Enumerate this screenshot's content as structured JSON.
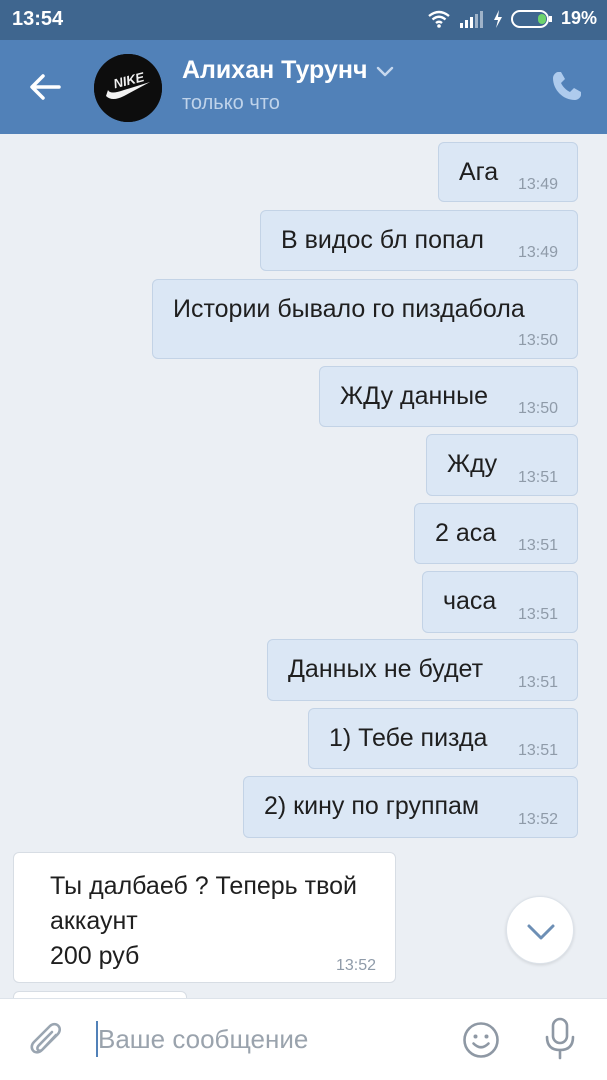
{
  "status_bar": {
    "time": "13:54",
    "battery": "19%"
  },
  "header": {
    "contact_name": "Алихан Турунч",
    "contact_status": "только что",
    "avatar_text": "NIKE"
  },
  "messages_out": [
    {
      "text": "Ага",
      "time": "13:49"
    },
    {
      "text": "В видос бл попал",
      "time": "13:49"
    },
    {
      "text": "Истории бывало го пиздабола",
      "time": "13:50"
    },
    {
      "text": "ЖДу данные",
      "time": "13:50"
    },
    {
      "text": "Жду",
      "time": "13:51"
    },
    {
      "text": "2 аса",
      "time": "13:51"
    },
    {
      "text": "часа",
      "time": "13:51"
    },
    {
      "text": "Данных не будет",
      "time": "13:51"
    },
    {
      "text": "1) Тебе пизда",
      "time": "13:51"
    },
    {
      "text": "2) кину по группам",
      "time": "13:52"
    }
  ],
  "message_in": {
    "text": "Ты далбаеб ? Теперь твой\nаккаунт\n200 руб",
    "time": "13:52"
  },
  "composer": {
    "placeholder": "Ваше сообщение"
  },
  "icons": {
    "back": "arrow-left-icon",
    "phone": "phone-icon",
    "scroll_down": "chevron-down-icon",
    "attach": "paperclip-icon",
    "emoji": "smiley-icon",
    "mic": "microphone-icon"
  },
  "colors": {
    "header": "#5181b8",
    "status_bar": "#3f668f",
    "outgoing_bubble": "#dbe7f5",
    "chat_background": "#ebeff4"
  }
}
